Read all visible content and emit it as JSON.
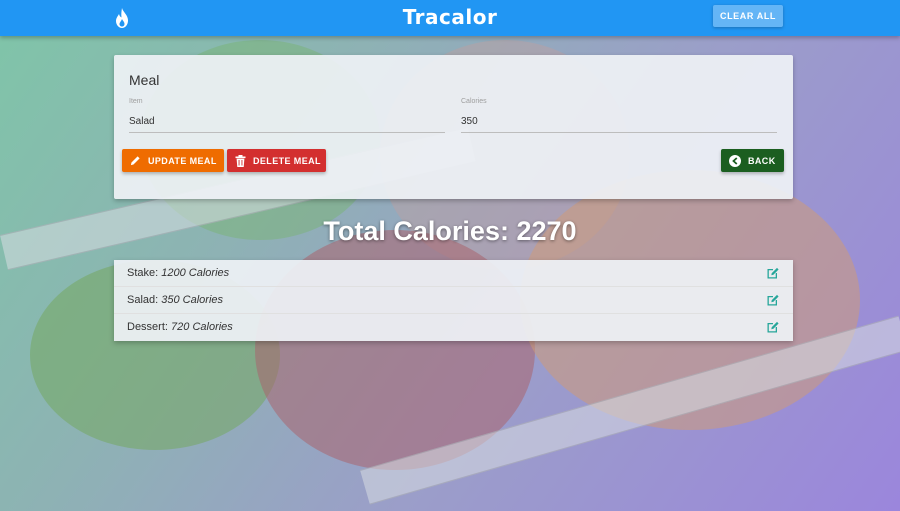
{
  "navbar": {
    "brand": "Tracalor",
    "brand_icon": "flame-icon",
    "clear_all_label": "CLEAR ALL"
  },
  "form": {
    "title": "Meal",
    "item_label": "Item",
    "item_value": "Salad",
    "calories_label": "Calories",
    "calories_value": "350",
    "update_label": "UPDATE MEAL",
    "delete_label": "DELETE MEAL",
    "back_label": "BACK"
  },
  "total": {
    "label": "Total Calories:",
    "value": "2270"
  },
  "meals": [
    {
      "name": "Stake:",
      "calories": "1200 Calories"
    },
    {
      "name": "Salad:",
      "calories": "350 Calories"
    },
    {
      "name": "Dessert:",
      "calories": "720 Calories"
    }
  ],
  "colors": {
    "primary": "#2196f3",
    "update": "#ef6c00",
    "delete": "#d32f2f",
    "back": "#1b5e20",
    "edit_icon": "#26a69a"
  }
}
